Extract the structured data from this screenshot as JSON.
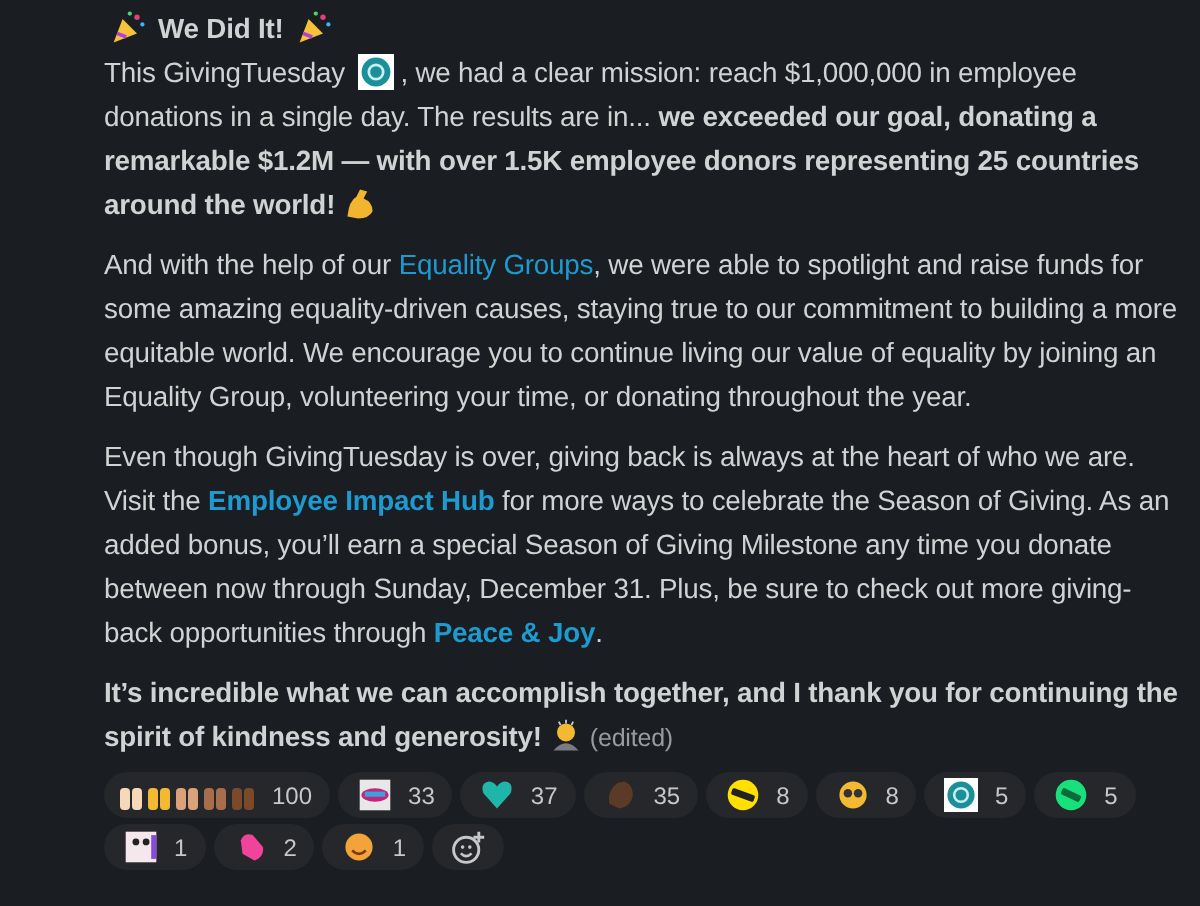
{
  "message": {
    "title": [
      {
        "kind": "popper"
      },
      {
        "kind": "bold",
        "text": "We Did It!"
      },
      {
        "kind": "popper"
      }
    ],
    "paragraphs": [
      [
        {
          "kind": "text",
          "text": "This GivingTuesday "
        },
        {
          "kind": "giving"
        },
        {
          "kind": "text",
          "text": ", we had a clear mission: reach $1,000,000 in employee donations in a single day. The results are in... "
        },
        {
          "kind": "bold",
          "text": "we exceeded our goal, donating a remarkable $1.2M — with over 1.5K employee donors representing 25 countries around the world!"
        },
        {
          "kind": "muscle"
        }
      ],
      [
        {
          "kind": "text",
          "text": "And with the help of our "
        },
        {
          "kind": "link",
          "text": "Equality Groups"
        },
        {
          "kind": "text",
          "text": ", we were able to spotlight and raise funds for some amazing equality-driven causes, staying true to our commitment to building a more equitable world. We encourage you to continue living our value of equality by joining an Equality Group, volunteering your time, or donating throughout the year."
        }
      ],
      [
        {
          "kind": "text",
          "text": "Even though GivingTuesday is over, giving back is always at the heart of who we are. Visit the "
        },
        {
          "kind": "boldlink",
          "text": "Employee Impact Hub"
        },
        {
          "kind": "text",
          "text": " for more ways to celebrate the Season of Giving. As an added bonus, you’ll earn a special Season of Giving Milestone any time you donate between now through Sunday, December 31. Plus, be sure to check out more giving-back opportunities through "
        },
        {
          "kind": "boldlink",
          "text": "Peace & Joy"
        },
        {
          "kind": "text",
          "text": "."
        }
      ],
      [
        {
          "kind": "bold",
          "text": "It’s incredible what we can accomplish together, and I thank you for continuing the spirit of kindness and generosity!"
        },
        {
          "kind": "bow"
        },
        {
          "kind": "muted",
          "text": "(edited)"
        }
      ]
    ]
  },
  "reactions": [
    {
      "kind": "hands",
      "count": "100"
    },
    {
      "kind": "sticker",
      "count": "33"
    },
    {
      "kind": "heart",
      "count": "37"
    },
    {
      "kind": "clap",
      "count": "35"
    },
    {
      "kind": "omg",
      "count": "8"
    },
    {
      "kind": "shades",
      "count": "8"
    },
    {
      "kind": "giving",
      "count": "5"
    },
    {
      "kind": "wow",
      "count": "5"
    },
    {
      "kind": "face",
      "count": "1"
    },
    {
      "kind": "mitten",
      "count": "2"
    },
    {
      "kind": "smile",
      "count": "1"
    }
  ]
}
